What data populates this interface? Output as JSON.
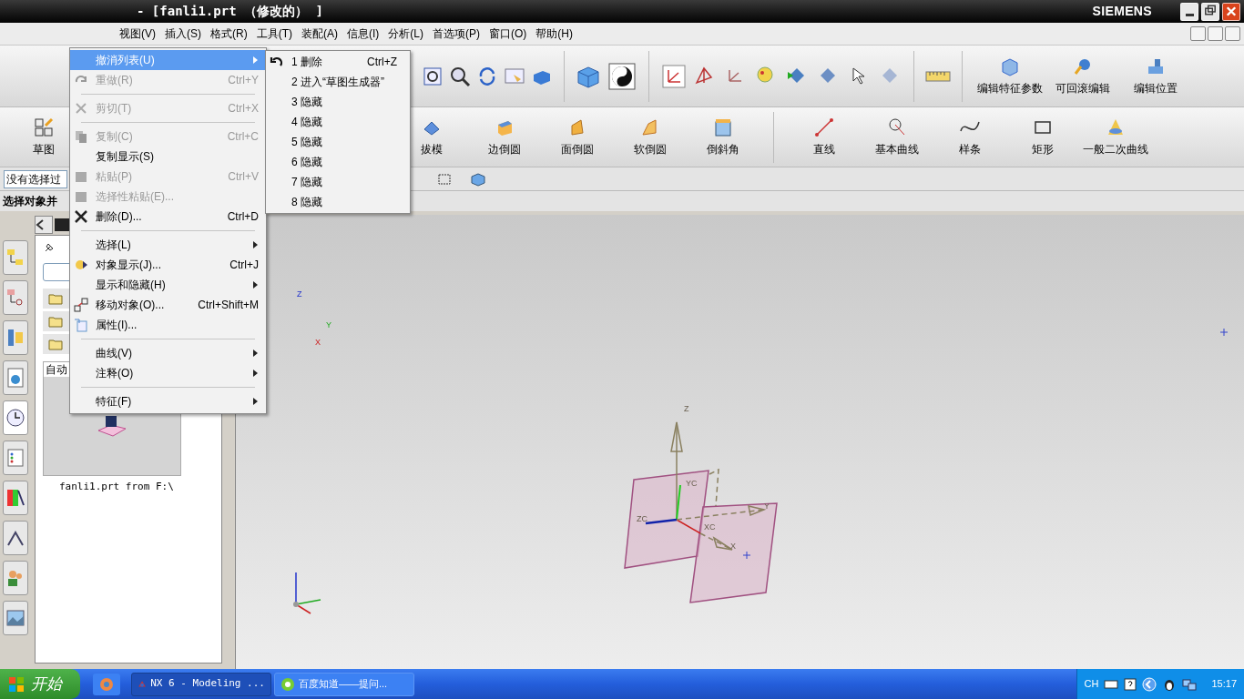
{
  "title_bar": {
    "title": "- [fanli1.prt （修改的） ]",
    "brand": "SIEMENS"
  },
  "menu_bar": [
    {
      "label": "视图(V)"
    },
    {
      "label": "插入(S)"
    },
    {
      "label": "格式(R)"
    },
    {
      "label": "工具(T)"
    },
    {
      "label": "装配(A)"
    },
    {
      "label": "信息(I)"
    },
    {
      "label": "分析(L)"
    },
    {
      "label": "首选项(P)"
    },
    {
      "label": "窗口(O)"
    },
    {
      "label": "帮助(H)"
    }
  ],
  "edit_toolbar": [
    "编辑特征参数",
    "可回滚编辑",
    "编辑位置"
  ],
  "feature_toolbar": [
    "草图",
    "拔模",
    "边倒圆",
    "面倒圆",
    "软倒圆",
    "倒斜角"
  ],
  "curve_toolbar": [
    "直线",
    "基本曲线",
    "样条",
    "矩形",
    "一般二次曲线"
  ],
  "selection_bar": {
    "filter": "没有选择过"
  },
  "resource_tabs": [
    {
      "selected": false
    },
    {
      "selected": false
    },
    {
      "selected": false
    },
    {
      "selected": false
    },
    {
      "selected": true
    },
    {
      "selected": false
    },
    {
      "selected": false
    },
    {
      "selected": false
    },
    {
      "selected": false
    },
    {
      "selected": false
    }
  ],
  "status_bar": {
    "prompt": "选择对象并"
  },
  "navigator": {
    "preview_label": "自动",
    "caption": "fanli1.prt from F:\\"
  },
  "view_triad": [
    "Z",
    "Y",
    "X"
  ],
  "model_axes": [
    "Z",
    "ZC",
    "YC",
    "XC",
    "Y",
    "X"
  ],
  "edit_menu": [
    {
      "kind": "item",
      "label": "撤消列表(U)",
      "submenu": true,
      "disabled": false,
      "selected": true
    },
    {
      "kind": "item",
      "label": "重做(R)",
      "shortcut": "Ctrl+Y",
      "disabled": true,
      "selected": false
    },
    {
      "kind": "separator"
    },
    {
      "kind": "item",
      "label": "剪切(T)",
      "shortcut": "Ctrl+X",
      "disabled": true,
      "selected": false
    },
    {
      "kind": "separator"
    },
    {
      "kind": "item",
      "label": "复制(C)",
      "shortcut": "Ctrl+C",
      "disabled": true,
      "selected": false
    },
    {
      "kind": "item",
      "label": "复制显示(S)",
      "disabled": false,
      "selected": false
    },
    {
      "kind": "item",
      "label": "粘贴(P)",
      "shortcut": "Ctrl+V",
      "disabled": true,
      "selected": false
    },
    {
      "kind": "item",
      "label": "选择性粘贴(E)...",
      "disabled": true,
      "selected": false
    },
    {
      "kind": "item",
      "label": "删除(D)...",
      "shortcut": "Ctrl+D",
      "disabled": false,
      "selected": false
    },
    {
      "kind": "separator"
    },
    {
      "kind": "item",
      "label": "选择(L)",
      "submenu": true,
      "disabled": false,
      "selected": false
    },
    {
      "kind": "item",
      "label": "对象显示(J)...",
      "shortcut": "Ctrl+J",
      "disabled": false,
      "selected": false
    },
    {
      "kind": "item",
      "label": "显示和隐藏(H)",
      "submenu": true,
      "disabled": false,
      "selected": false
    },
    {
      "kind": "item",
      "label": "移动对象(O)...",
      "shortcut": "Ctrl+Shift+M",
      "disabled": false,
      "selected": false
    },
    {
      "kind": "item",
      "label": "属性(I)...",
      "disabled": false,
      "selected": false
    },
    {
      "kind": "separator"
    },
    {
      "kind": "item",
      "label": "曲线(V)",
      "submenu": true,
      "disabled": false,
      "selected": false
    },
    {
      "kind": "item",
      "label": "注释(O)",
      "submenu": true,
      "disabled": false,
      "selected": false
    },
    {
      "kind": "separator"
    },
    {
      "kind": "item",
      "label": "特征(F)",
      "submenu": true,
      "disabled": false,
      "selected": false
    }
  ],
  "undo_submenu": [
    {
      "label": "1 删除",
      "shortcut": "Ctrl+Z"
    },
    {
      "label": "2 进入“草图生成器”"
    },
    {
      "label": "3 隐藏"
    },
    {
      "label": "4 隐藏"
    },
    {
      "label": "5 隐藏"
    },
    {
      "label": "6 隐藏"
    },
    {
      "label": "7 隐藏"
    },
    {
      "label": "8 隐藏"
    }
  ],
  "taskbar": {
    "start": "开始",
    "tasks": [
      {
        "label": "NX 6 - Modeling ...",
        "selected": true
      },
      {
        "label": "百度知道——提问...",
        "selected": false
      }
    ],
    "language": "CH",
    "clock": "15:17"
  }
}
